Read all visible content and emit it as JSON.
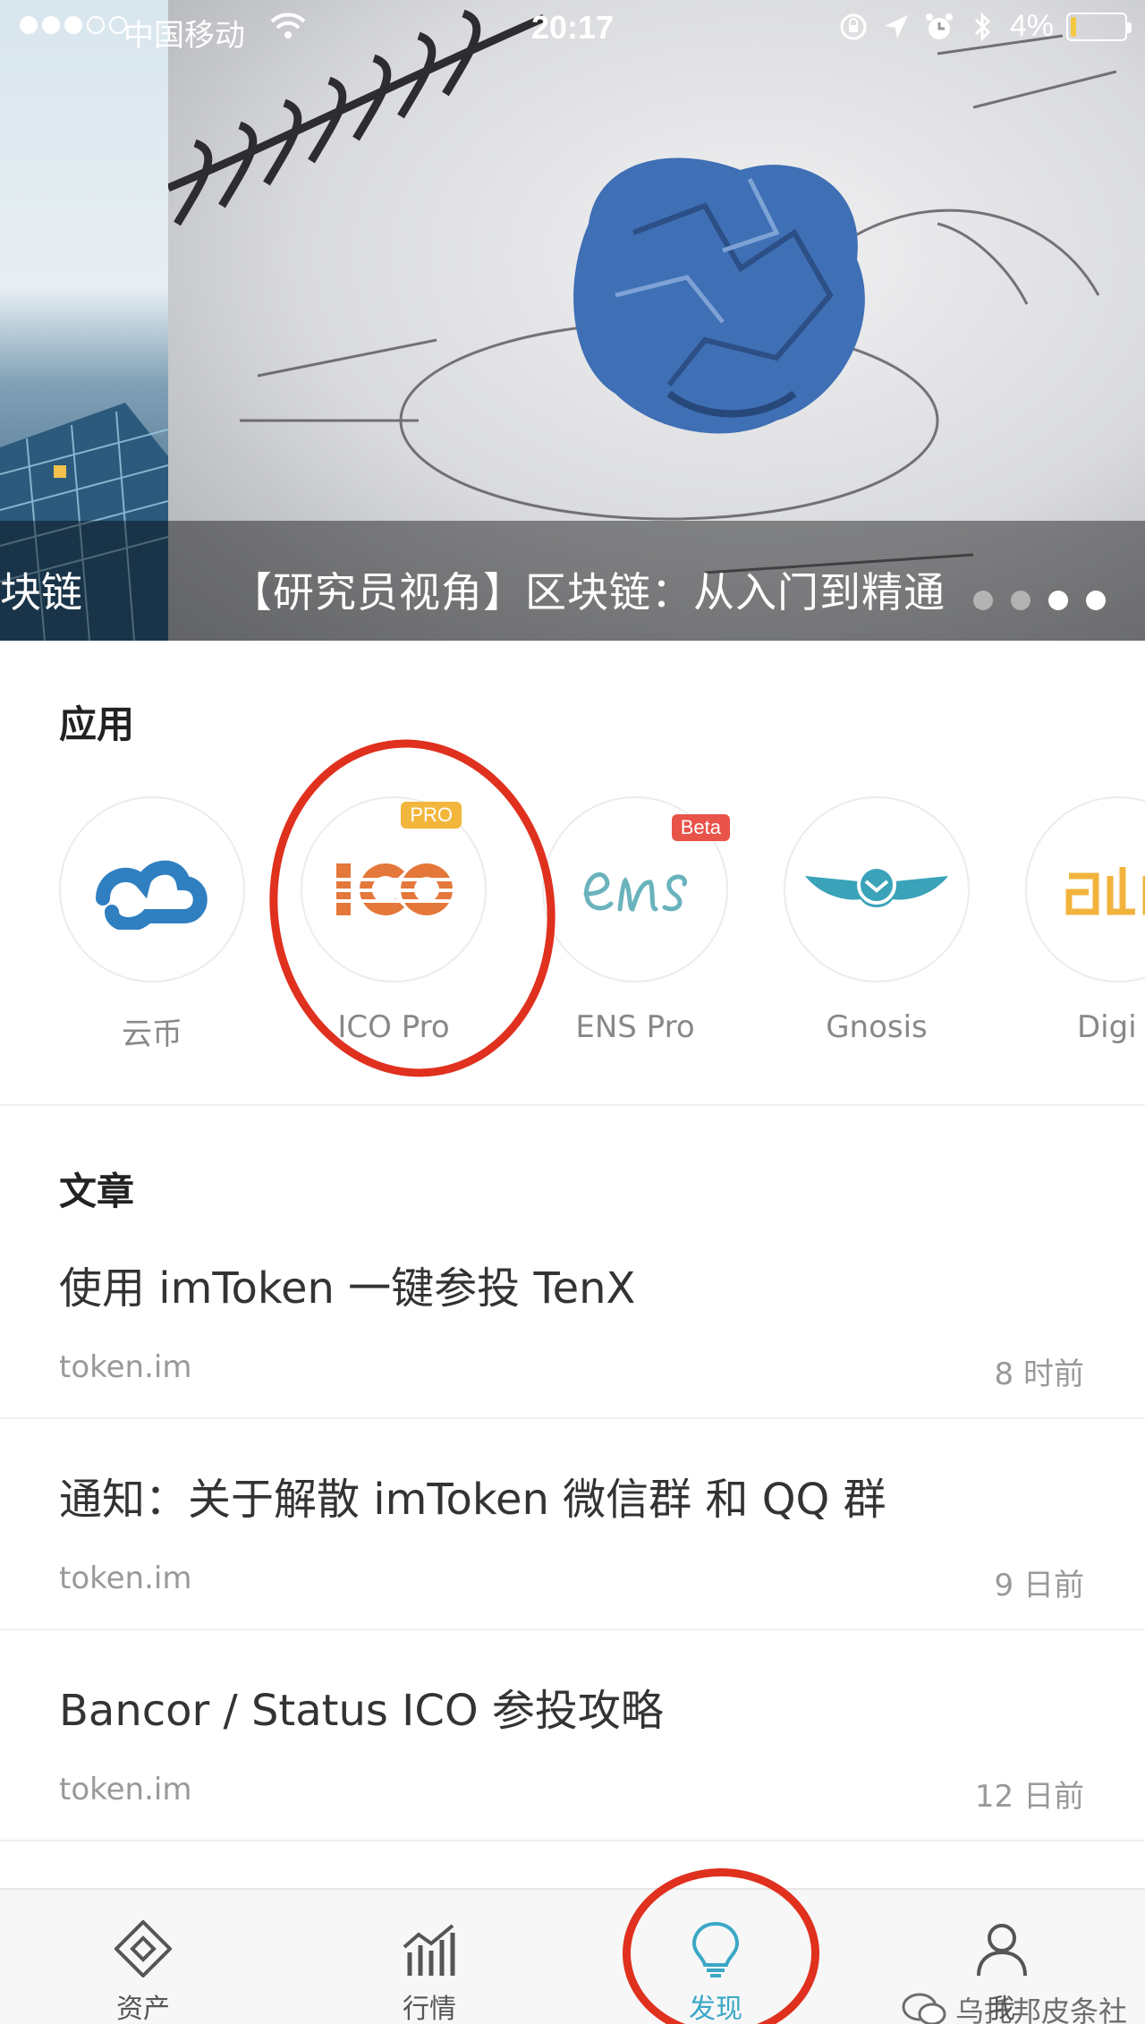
{
  "status_bar": {
    "carrier": "中国移动",
    "time": "20:17",
    "battery": "4%",
    "battery_level": 0.04
  },
  "banner": {
    "caption": "【研究员视角】区块链：从入门到精通",
    "prev_caption": "块链",
    "page_count": 4,
    "active_page": 3
  },
  "apps_section": {
    "title": "应用",
    "items": [
      {
        "label": "云币",
        "icon": "yunbi-logo-icon"
      },
      {
        "label": "ICO Pro",
        "icon": "ico-logo-icon",
        "badge": "PRO",
        "badge_color": "#f3b63c"
      },
      {
        "label": "ENS Pro",
        "icon": "ens-logo-icon",
        "badge": "Beta",
        "badge_color": "#e8534a"
      },
      {
        "label": "Gnosis",
        "icon": "gnosis-owl-icon"
      },
      {
        "label": "Digi",
        "icon": "digix-logo-icon"
      }
    ]
  },
  "articles_section": {
    "title": "文章",
    "items": [
      {
        "title": "使用 imToken 一键参投 TenX",
        "source": "token.im",
        "time": "8 时前"
      },
      {
        "title": "通知：关于解散 imToken 微信群 和 QQ 群",
        "source": "token.im",
        "time": "9 日前"
      },
      {
        "title": "Bancor / Status ICO 参投攻略",
        "source": "token.im",
        "time": "12 日前"
      }
    ]
  },
  "tabbar": {
    "tabs": [
      {
        "label": "资产",
        "icon": "wallet-diamond-icon"
      },
      {
        "label": "行情",
        "icon": "market-chart-icon"
      },
      {
        "label": "发现",
        "icon": "lightbulb-icon",
        "active": true
      },
      {
        "label": "我",
        "icon": "profile-person-icon"
      }
    ]
  },
  "watermark": "乌托邦皮条社",
  "colors": {
    "accent": "#3aa8c5",
    "annotation": "#e0301e",
    "ico_orange": "#e4773a",
    "yunbi_blue": "#2f7fc1",
    "gnosis_teal": "#3aa3b9",
    "digix_yellow": "#f2b33d"
  }
}
